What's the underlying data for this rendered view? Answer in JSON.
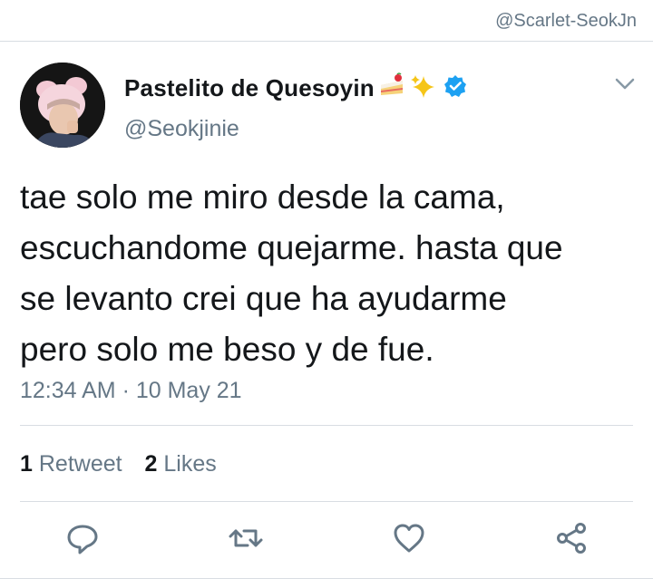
{
  "watermark": "@Scarlet-SeokJn",
  "user": {
    "display_name": "Pastelito de Quesoyin",
    "handle": "@Seokjinie",
    "verified": true,
    "name_emojis": [
      "cake-emoji",
      "sparkles-emoji"
    ]
  },
  "tweet": {
    "lines": [
      "tae solo me miro desde la cama,",
      "escuchandome quejarme. hasta que",
      "se levanto crei que ha ayudarme",
      "pero solo me beso y de fue."
    ],
    "timestamp": "12:34 AM · 10 May 21"
  },
  "stats": {
    "retweets_count": "1",
    "retweets_label": "Retweet",
    "likes_count": "2",
    "likes_label": "Likes"
  },
  "actions": [
    "reply-icon",
    "retweet-icon",
    "like-icon",
    "share-icon"
  ],
  "colors": {
    "text": "#14171a",
    "secondary": "#657786",
    "verified": "#1da1f2",
    "divider": "#d8dde2"
  }
}
